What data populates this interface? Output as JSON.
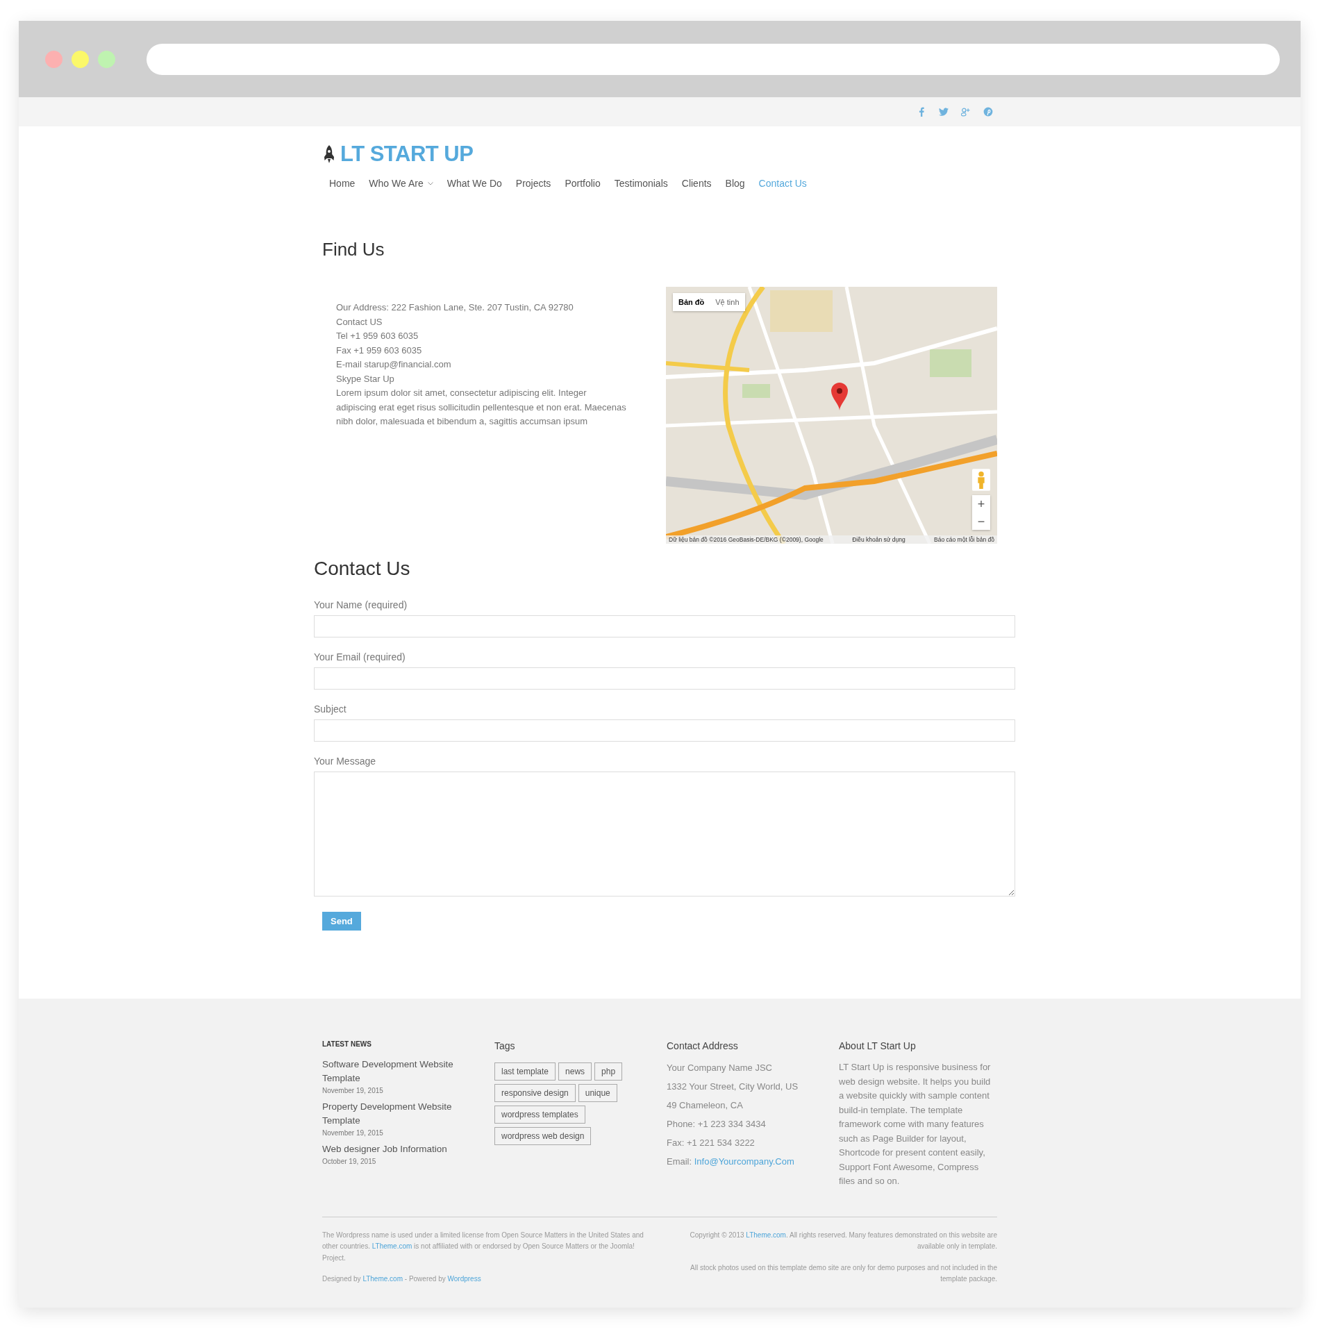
{
  "social_links": [
    {
      "kind": "facebook"
    },
    {
      "kind": "twitter"
    },
    {
      "kind": "googleplus"
    },
    {
      "kind": "pinterest"
    }
  ],
  "logo": {
    "text": "LT START UP"
  },
  "nav": [
    {
      "label": "Home",
      "kind": "link",
      "selected": false
    },
    {
      "label": "Who We Are",
      "kind": "dropdown",
      "selected": false
    },
    {
      "label": "What We Do",
      "kind": "link",
      "selected": false
    },
    {
      "label": "Projects",
      "kind": "link",
      "selected": false
    },
    {
      "label": "Portfolio",
      "kind": "link",
      "selected": false
    },
    {
      "label": "Testimonials",
      "kind": "link",
      "selected": false
    },
    {
      "label": "Clients",
      "kind": "link",
      "selected": false
    },
    {
      "label": "Blog",
      "kind": "link",
      "selected": false
    },
    {
      "label": "Contact Us",
      "kind": "link",
      "selected": true
    }
  ],
  "find_us": {
    "title": "Find Us",
    "lines": [
      "Our Address: 222 Fashion Lane, Ste. 207 Tustin, CA 92780",
      "Contact US",
      "Tel +1 959 603 6035",
      "Fax +1 959 603 6035",
      "E-mail starup@financial.com",
      "Skype Star Up"
    ],
    "paragraph": "Lorem ipsum dolor sit amet, consectetur adipiscing elit. Integer adipiscing erat eget risus sollicitudin pellentesque et non erat. Maecenas nibh dolor, malesuada et bibendum a, sagittis accumsan ipsum",
    "map": {
      "kind": "picture",
      "map_types": [
        {
          "label": "Bản đồ",
          "selected": true
        },
        {
          "label": "Vệ tinh",
          "selected": false
        }
      ],
      "zoom_in": "+",
      "zoom_out": "−",
      "attribution": [
        "Dữ liệu bản đồ ©2016 GeoBasis-DE/BKG (©2009), Google",
        "Điều khoản sử dụng",
        "Báo cáo một lỗi bản đồ"
      ]
    }
  },
  "contact_form": {
    "title": "Contact Us",
    "fields": [
      {
        "label": "Your Name (required)",
        "kind": "input"
      },
      {
        "label": "Your Email (required)",
        "kind": "input"
      },
      {
        "label": "Subject",
        "kind": "input"
      },
      {
        "label": "Your Message",
        "kind": "textarea"
      }
    ],
    "submit": "Send"
  },
  "footer": {
    "latest_news": {
      "title": "LATEST NEWS",
      "items": [
        {
          "title": "Software Development Website Template",
          "date": "November 19, 2015"
        },
        {
          "title": "Property Development Website Template",
          "date": "November 19, 2015"
        },
        {
          "title": "Web designer Job Information",
          "date": "October 19, 2015"
        }
      ]
    },
    "tags": {
      "title": "Tags",
      "items": [
        "last template",
        "news",
        "php",
        "responsive design",
        "unique",
        "wordpress templates",
        "wordpress web design"
      ]
    },
    "contact_address": {
      "title": "Contact Address",
      "lines": [
        "Your Company Name JSC",
        "1332 Your Street, City World, US",
        "49 Chameleon, CA",
        "Phone: +1 223 334 3434",
        "Fax: +1 221 534 3222"
      ],
      "email_label": "Email:",
      "email": "Info@Yourcompany.Com"
    },
    "about": {
      "title": "About LT Start Up",
      "text": "LT Start Up is responsive business for web design website. It helps you build a website quickly with sample content build-in template. The template framework come with many features such as Page Builder for layout, Shortcode for present content easily, Support Font Awesome, Compress files and so on."
    },
    "legal": [
      {
        "kind": "text",
        "text": "The Wordpress name is used under a limited license from Open Source Matters in the United States and other countries. "
      },
      {
        "kind": "link",
        "text": "LTheme.com"
      },
      {
        "kind": "text",
        "text": " is not affiliated with or endorsed by Open Source Matters or the Joomla! Project."
      }
    ],
    "credits": [
      {
        "kind": "text",
        "text": "Designed by "
      },
      {
        "kind": "link",
        "text": "LTheme.com"
      },
      {
        "kind": "text",
        "text": " - Powered by "
      },
      {
        "kind": "link",
        "text": "Wordpress"
      }
    ],
    "copyright": [
      {
        "kind": "text",
        "text": "Copyright © 2013 "
      },
      {
        "kind": "link",
        "text": "LTheme.com"
      },
      {
        "kind": "text",
        "text": ". All rights reserved. Many features demonstrated on this website are available only in template."
      }
    ],
    "stock_note": "All stock photos used on this template demo site are only for demo purposes and not included in the template package."
  }
}
